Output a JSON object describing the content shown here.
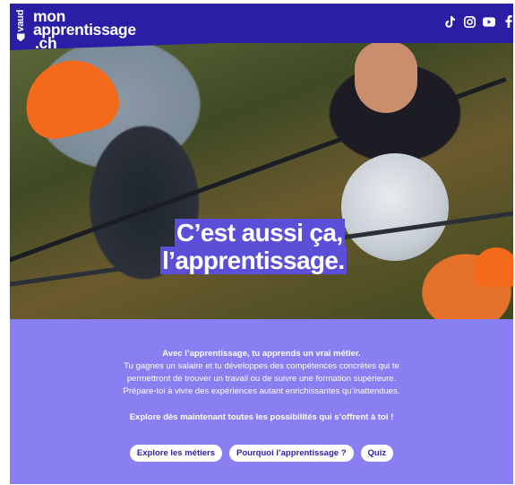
{
  "header": {
    "canton": "vaud",
    "logo_lines": [
      "mon",
      "apprentissage",
      ".ch"
    ],
    "socials": [
      {
        "icon": "tiktok-icon",
        "glyph": "♪"
      },
      {
        "icon": "instagram-icon",
        "glyph": "◎"
      },
      {
        "icon": "youtube-icon",
        "glyph": "▶"
      },
      {
        "icon": "facebook-icon",
        "glyph": "f"
      }
    ]
  },
  "hero": {
    "headline_line1": "C’est aussi ça,",
    "headline_line2": "l’apprentissage."
  },
  "intro": {
    "lead": "Avec l’apprentissage, tu apprends un vrai métier.",
    "line2": "Tu gagnes un salaire et tu développes des compétences concrètes qui te",
    "line3": "permettront de trouver un travail ou de suivre une formation supérieure.",
    "line4": "Prépare-toi à vivre des expériences autant enrichissantes qu’inattendues."
  },
  "explore_text": "Explore dès maintenant toutes les possibilités qui s’offrent à toi !",
  "buttons": {
    "metiers": "Explore les métiers",
    "pourquoi": "Pourquoi l’apprentissage ?",
    "quiz": "Quiz"
  },
  "colors": {
    "header_bg": "#2a1da6",
    "panel_bg": "#8a7ff2",
    "highlight": "#5b4fd8",
    "button_text": "#2a1da6"
  }
}
